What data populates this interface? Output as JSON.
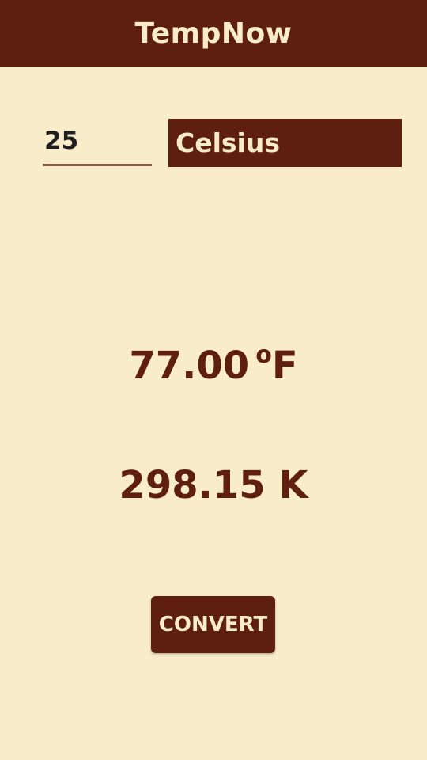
{
  "app_bar": {
    "title": "TempNow"
  },
  "input": {
    "value": "25"
  },
  "unit_select": {
    "selected": "Celsius"
  },
  "results": {
    "fahrenheit_value": "77.00",
    "fahrenheit_degree_symbol": "o",
    "fahrenheit_unit": "F",
    "kelvin": "298.15 K"
  },
  "convert_button": {
    "label": "CONVERT"
  },
  "colors": {
    "background": "#f9ecca",
    "primary": "#5e1f10",
    "on_primary": "#f9ecca"
  }
}
